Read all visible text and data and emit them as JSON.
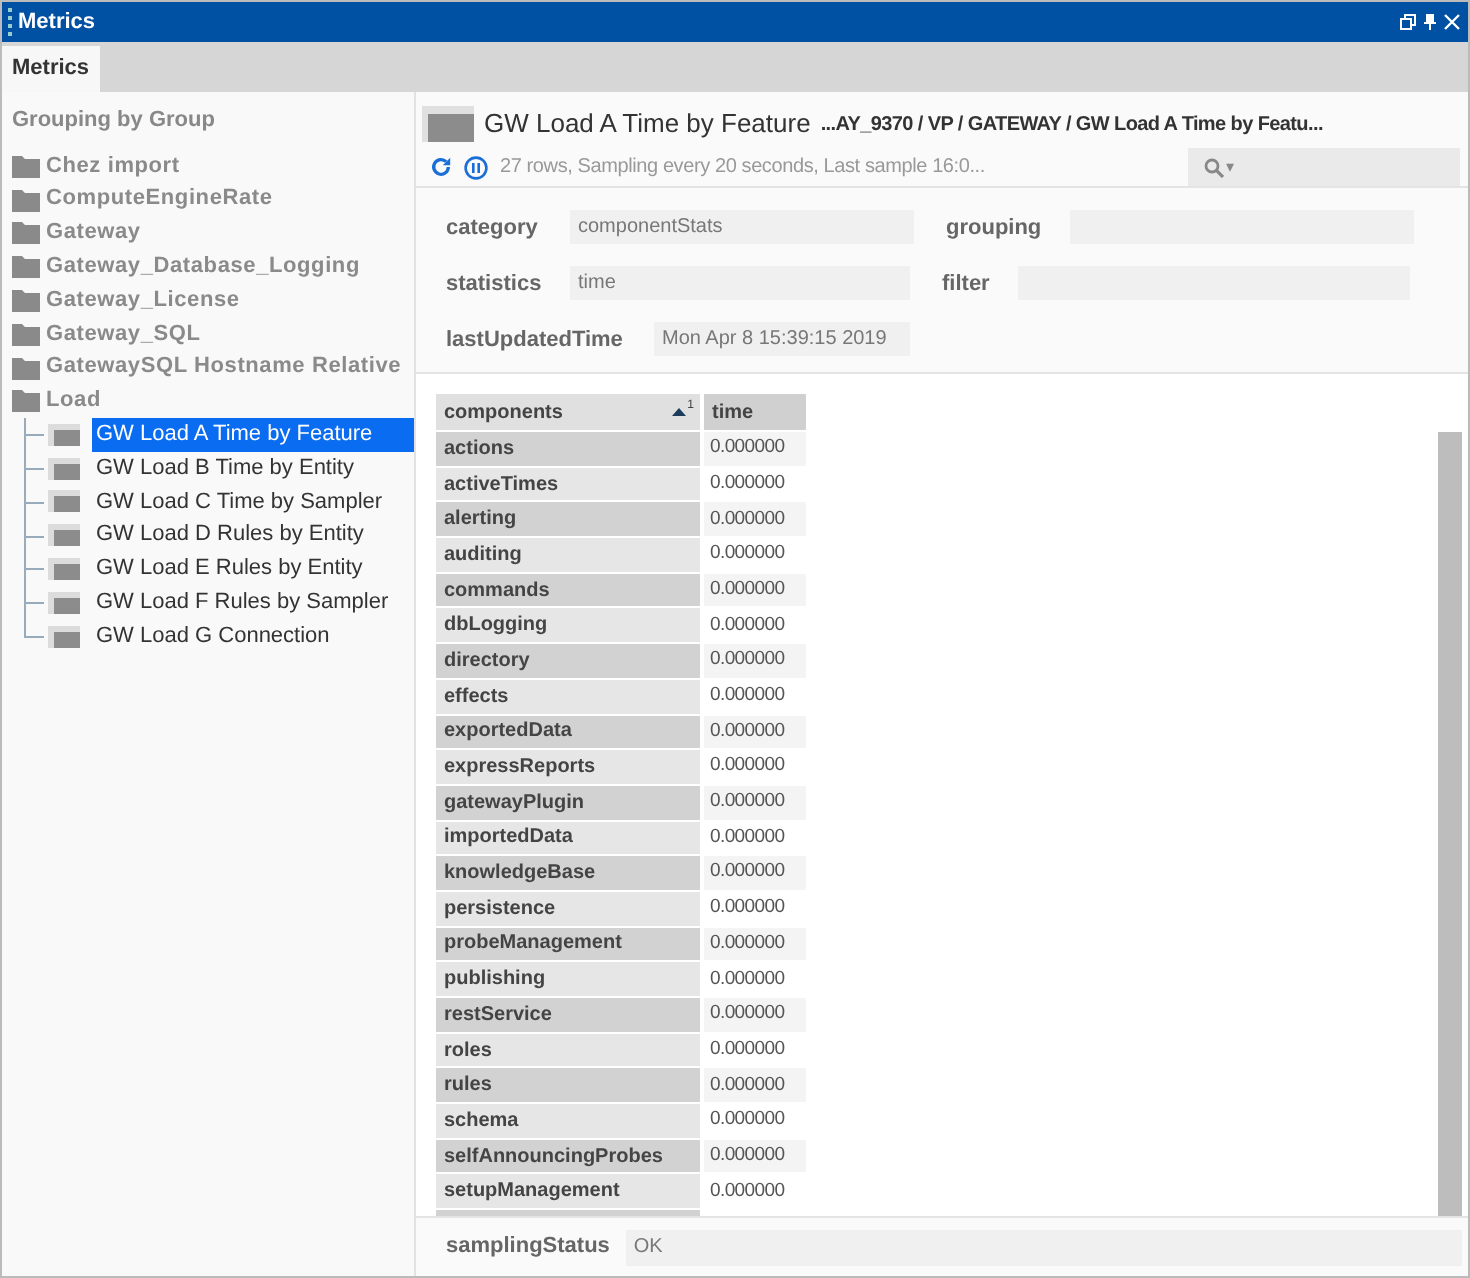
{
  "window": {
    "title": "Metrics"
  },
  "tabs": [
    {
      "label": "Metrics",
      "selected": true
    }
  ],
  "sidebar": {
    "heading": "Grouping by Group",
    "tree": [
      {
        "label": "Chez import"
      },
      {
        "label": "ComputeEngineRate"
      },
      {
        "label": "Gateway"
      },
      {
        "label": "Gateway_Database_Logging"
      },
      {
        "label": "Gateway_License"
      },
      {
        "label": "Gateway_SQL"
      },
      {
        "label": "GatewaySQL Hostname Relative"
      },
      {
        "label": "Load",
        "children": [
          {
            "label": "GW Load A Time by Feature",
            "selected": true
          },
          {
            "label": "GW Load B Time by Entity",
            "selected": false
          },
          {
            "label": "GW Load C Time by Sampler",
            "selected": false
          },
          {
            "label": "GW Load D Rules by Entity",
            "selected": false
          },
          {
            "label": "GW Load E Rules by Entity",
            "selected": false
          },
          {
            "label": "GW Load F Rules by Sampler",
            "selected": false
          },
          {
            "label": "GW Load G Connection",
            "selected": false
          }
        ]
      }
    ]
  },
  "view": {
    "title": "GW Load A Time by Feature",
    "path": "...AY_9370 / VP / GATEWAY / GW Load A Time by Featu...",
    "status": "27 rows, Sampling every 20 seconds, Last sample 16:0...",
    "search_icon_caret": "▾",
    "fields": [
      {
        "label": "category",
        "value": "componentStats"
      },
      {
        "label": "grouping"
      },
      {
        "label": "statistics",
        "value": "time"
      },
      {
        "label": "filter"
      },
      {
        "label": "lastUpdatedTime",
        "value": "Mon Apr  8 15:39:15 2019"
      }
    ],
    "table": {
      "columns": [
        {
          "label": "components",
          "sort": "1"
        },
        {
          "label": "time"
        }
      ],
      "rows": [
        [
          "actions",
          "0.000000"
        ],
        [
          "activeTimes",
          "0.000000"
        ],
        [
          "alerting",
          "0.000000"
        ],
        [
          "auditing",
          "0.000000"
        ],
        [
          "commands",
          "0.000000"
        ],
        [
          "dbLogging",
          "0.000000"
        ],
        [
          "directory",
          "0.000000"
        ],
        [
          "effects",
          "0.000000"
        ],
        [
          "exportedData",
          "0.000000"
        ],
        [
          "expressReports",
          "0.000000"
        ],
        [
          "gatewayPlugin",
          "0.000000"
        ],
        [
          "importedData",
          "0.000000"
        ],
        [
          "knowledgeBase",
          "0.000000"
        ],
        [
          "persistence",
          "0.000000"
        ],
        [
          "probeManagement",
          "0.000000"
        ],
        [
          "publishing",
          "0.000000"
        ],
        [
          "restService",
          "0.000000"
        ],
        [
          "roles",
          "0.000000"
        ],
        [
          "rules",
          "0.000000"
        ],
        [
          "schema",
          "0.000000"
        ],
        [
          "selfAnnouncingProbes",
          "0.000000"
        ],
        [
          "setupManagement",
          "0.000000"
        ]
      ]
    },
    "sampling_status": {
      "label": "samplingStatus",
      "value": "OK"
    }
  }
}
